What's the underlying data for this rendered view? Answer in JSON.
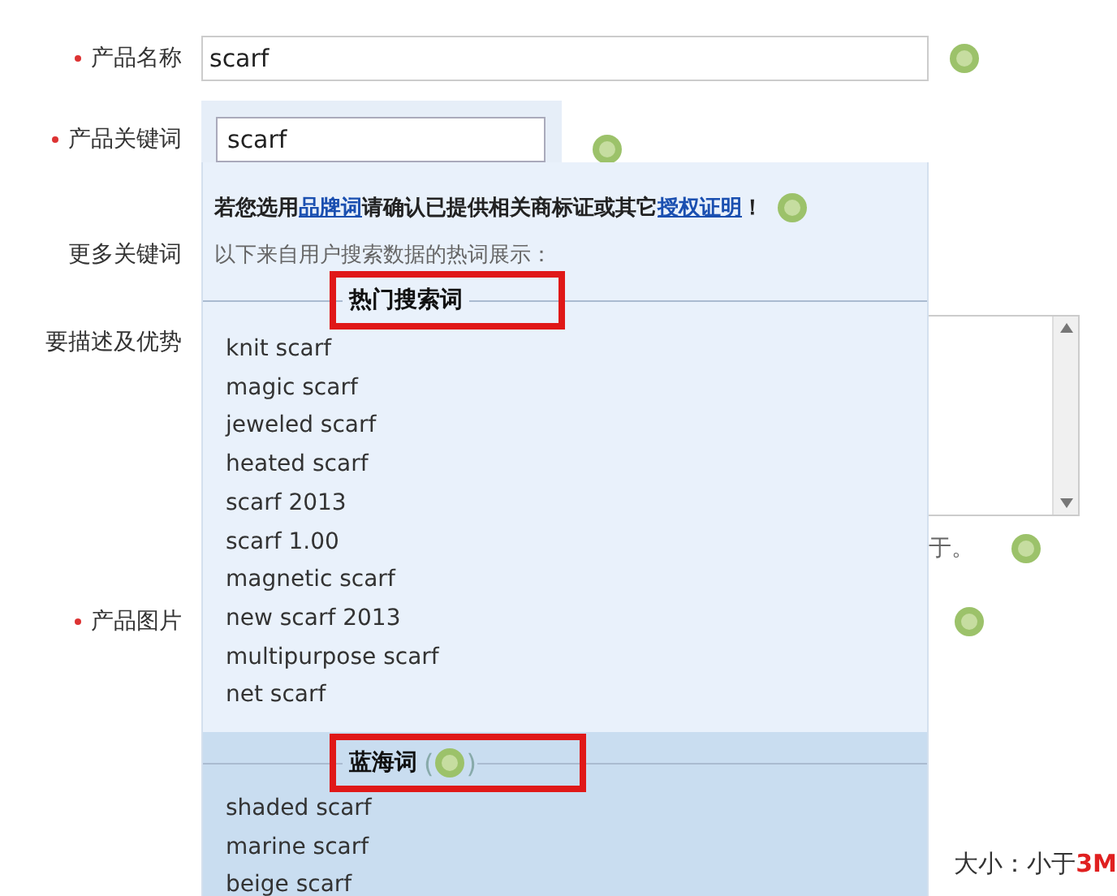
{
  "form": {
    "fields": [
      {
        "kind": "text",
        "label": "产品名称",
        "required": true,
        "value": "scarf"
      },
      {
        "kind": "keyword",
        "label": "产品关键词",
        "required": true
      },
      {
        "kind": "plain",
        "label": "更多关键词",
        "required": false
      },
      {
        "kind": "textarea",
        "label": "要描述及优势",
        "required": false
      },
      {
        "kind": "hint",
        "text": "于。"
      },
      {
        "kind": "image",
        "label": "产品图片",
        "required": true
      }
    ],
    "size_note": {
      "text": "大小：小于",
      "highlight": "3M"
    }
  },
  "suggestion_panel": {
    "keyword_value": "scarf",
    "notice": {
      "before": "若您选用",
      "link1": "品牌词",
      "middle": "请确认已提供相关商标证或其它",
      "link2": "授权证明",
      "after": "！"
    },
    "intro": "以下来自用户搜索数据的热词展示：",
    "sections": [
      {
        "kind": "hot",
        "title": "热门搜索词",
        "highlighted": true,
        "items": [
          "knit scarf",
          "magic scarf",
          "jeweled scarf",
          "heated scarf",
          "scarf 2013",
          "scarf 1.00",
          "magnetic scarf",
          "new scarf 2013",
          "multipurpose scarf",
          "net scarf"
        ]
      },
      {
        "kind": "blue",
        "title": "蓝海词",
        "parens": [
          "(",
          ")"
        ],
        "highlighted": true,
        "items": [
          "shaded scarf",
          "marine scarf",
          "beige scarf"
        ]
      }
    ]
  }
}
